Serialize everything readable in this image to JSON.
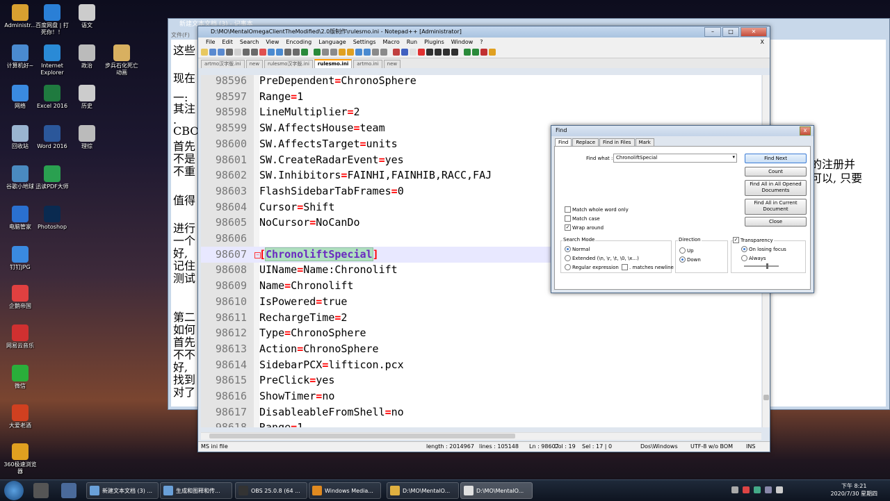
{
  "desktop_icons": [
    {
      "label": "Administr...",
      "icon": "folder-icon",
      "color": "#d8a030"
    },
    {
      "label": "百度网盘 | 打死你！！",
      "icon": "baidu-netdisk-icon",
      "color": "#2a7fd6"
    },
    {
      "label": "语文",
      "icon": "document-icon",
      "color": "#cccccc"
    },
    {
      "label": "计算机好~",
      "icon": "computer-icon",
      "color": "#4a8ad0"
    },
    {
      "label": "Internet Explorer",
      "icon": "ie-icon",
      "color": "#2a8ad6"
    },
    {
      "label": "政治",
      "icon": "star-icon",
      "color": "#bbbbbb"
    },
    {
      "label": "步兵石化死亡动画",
      "icon": "folder-icon",
      "color": "#d8b060"
    },
    {
      "label": "网络",
      "icon": "network-icon",
      "color": "#3a8ae0"
    },
    {
      "label": "Excel 2016",
      "icon": "excel-icon",
      "color": "#1f7a3f"
    },
    {
      "label": "历史",
      "icon": "document-icon",
      "color": "#cccccc"
    },
    {
      "label": "回收站",
      "icon": "recycle-bin-icon",
      "color": "#9ab4d0"
    },
    {
      "label": "Word 2016",
      "icon": "word-icon",
      "color": "#2b579a"
    },
    {
      "label": "理综",
      "icon": "document-icon",
      "color": "#bbbbbb"
    },
    {
      "label": "谷歌小地球",
      "icon": "google-earth-icon",
      "color": "#4a8ac0"
    },
    {
      "label": "迅读PDF大师",
      "icon": "pdf-icon",
      "color": "#2aa050"
    },
    {
      "label": "电脑管家",
      "icon": "pc-manager-icon",
      "color": "#2a70d0"
    },
    {
      "label": "Photoshop",
      "icon": "photoshop-icon",
      "color": "#0a2a50"
    },
    {
      "label": "钉钉JPG",
      "icon": "image-icon",
      "color": "#3a8ae0"
    },
    {
      "label": "企鹅帝国",
      "icon": "penguin-icon",
      "color": "#e04040"
    },
    {
      "label": "网易云音乐",
      "icon": "netease-music-icon",
      "color": "#d03030"
    },
    {
      "label": "微信",
      "icon": "wechat-icon",
      "color": "#2aae3a"
    },
    {
      "label": "大爱老酒",
      "icon": "app-icon",
      "color": "#d04020"
    },
    {
      "label": "360极速浏览器",
      "icon": "browser-360-icon",
      "color": "#e0a020"
    }
  ],
  "notepad": {
    "title": "新建文本文档 (3) - 记事本",
    "menu": "文件(F)",
    "left_text": [
      "这些",
      "现在",
      "一:",
      "其注",
      ".",
      "CBOI",
      "首先",
      "不是",
      "不重",
      "值得",
      "进行",
      "一个",
      "好,",
      "记住",
      "测试",
      "第二",
      "如何",
      "首先",
      "不不",
      "好,",
      "找到",
      "对了"
    ],
    "right_text": [
      "的注册并",
      "可以, 只要"
    ]
  },
  "npp": {
    "title": "D:\\MO\\MentalOmegaClientTheModified\\2.0版制作\\rulesmo.ini - Notepad++ [Administrator]",
    "menu": [
      "File",
      "Edit",
      "Search",
      "View",
      "Encoding",
      "Language",
      "Settings",
      "Macro",
      "Run",
      "Plugins",
      "Window",
      "?"
    ],
    "menu_close": "X",
    "tabs": [
      {
        "label": "artmo汉字版.ini",
        "active": false
      },
      {
        "label": "new",
        "active": false
      },
      {
        "label": "rulesmo汉字版.ini",
        "active": false
      },
      {
        "label": "rulesmo.ini",
        "active": true
      },
      {
        "label": "artmo.ini",
        "active": false
      },
      {
        "label": "new",
        "active": false
      }
    ],
    "lines": [
      {
        "num": "98596",
        "key": "PreDependent",
        "value": "ChronoSphere"
      },
      {
        "num": "98597",
        "key": "Range",
        "value": "1"
      },
      {
        "num": "98598",
        "key": "LineMultiplier",
        "value": "2"
      },
      {
        "num": "98599",
        "key": "SW.AffectsHouse",
        "value": "team"
      },
      {
        "num": "98600",
        "key": "SW.AffectsTarget",
        "value": "units"
      },
      {
        "num": "98601",
        "key": "SW.CreateRadarEvent",
        "value": "yes"
      },
      {
        "num": "98602",
        "key": "SW.Inhibitors",
        "value": "FAINHI,FAINHIB,RACC,FAJ"
      },
      {
        "num": "98603",
        "key": "FlashSidebarTabFrames",
        "value": "0"
      },
      {
        "num": "98604",
        "key": "Cursor",
        "value": "Shift"
      },
      {
        "num": "98605",
        "key": "NoCursor",
        "value": "NoCanDo"
      },
      {
        "num": "98606",
        "key": "",
        "value": ""
      },
      {
        "num": "98607",
        "section": "ChronoliftSpecial"
      },
      {
        "num": "98608",
        "key": "UIName",
        "value": "Name:Chronolift"
      },
      {
        "num": "98609",
        "key": "Name",
        "value": "Chronolift"
      },
      {
        "num": "98610",
        "key": "IsPowered",
        "value": "true"
      },
      {
        "num": "98611",
        "key": "RechargeTime",
        "value": "2"
      },
      {
        "num": "98612",
        "key": "Type",
        "value": "ChronoSphere"
      },
      {
        "num": "98613",
        "key": "Action",
        "value": "ChronoSphere"
      },
      {
        "num": "98614",
        "key": "SidebarPCX",
        "value": "lifticon.pcx"
      },
      {
        "num": "98615",
        "key": "PreClick",
        "value": "yes"
      },
      {
        "num": "98616",
        "key": "ShowTimer",
        "value": "no"
      },
      {
        "num": "98617",
        "key": "DisableableFromShell",
        "value": "no"
      },
      {
        "num": "98618",
        "key": "Range",
        "value": "1"
      }
    ],
    "status": {
      "type": "MS ini file",
      "length": "length : 2014967",
      "lines": "lines : 105148",
      "ln": "Ln : 98607",
      "col": "Col : 19",
      "sel": "Sel : 17 | 0",
      "eol": "Dos\\Windows",
      "encoding": "UTF-8 w/o BOM",
      "mode": "INS"
    }
  },
  "find": {
    "title": "Find",
    "close": "x",
    "tabs": [
      "Find",
      "Replace",
      "Find in Files",
      "Mark"
    ],
    "find_what_label": "Find what :",
    "find_what_value": "ChronoliftSpecial",
    "buttons": {
      "find_next": "Find Next",
      "count": "Count",
      "find_all_opened": "Find All in All Opened Documents",
      "find_all_current": "Find All in Current Document",
      "close": "Close"
    },
    "checks": {
      "match_whole_word": "Match whole word only",
      "match_case": "Match case",
      "wrap_around": "Wrap around"
    },
    "search_mode": {
      "title": "Search Mode",
      "normal": "Normal",
      "extended": "Extended (\\n, \\r, \\t, \\0, \\x...)",
      "regex": "Regular expression",
      "newline": ". matches newline"
    },
    "direction": {
      "title": "Direction",
      "up": "Up",
      "down": "Down"
    },
    "transparency": {
      "title": "Transparency",
      "losing_focus": "On losing focus",
      "always": "Always"
    }
  },
  "taskbar": {
    "items": [
      {
        "label": "新建文本文档 (3) ...",
        "color": "#6aa0d8"
      },
      {
        "label": "生成和图释和传...",
        "color": "#6aa0d8"
      },
      {
        "label": "OBS 25.0.8 (64 ...",
        "color": "#333333"
      },
      {
        "label": "Windows Media...",
        "color": "#e08a20"
      },
      {
        "label": "D:\\MO\\MentalO...",
        "color": "#e0b040"
      },
      {
        "label": "D:\\MO\\MentalO...",
        "color": "#e0e0e0"
      }
    ],
    "clock_time": "下午 8:21",
    "clock_date": "2020/7/30 星期四"
  }
}
